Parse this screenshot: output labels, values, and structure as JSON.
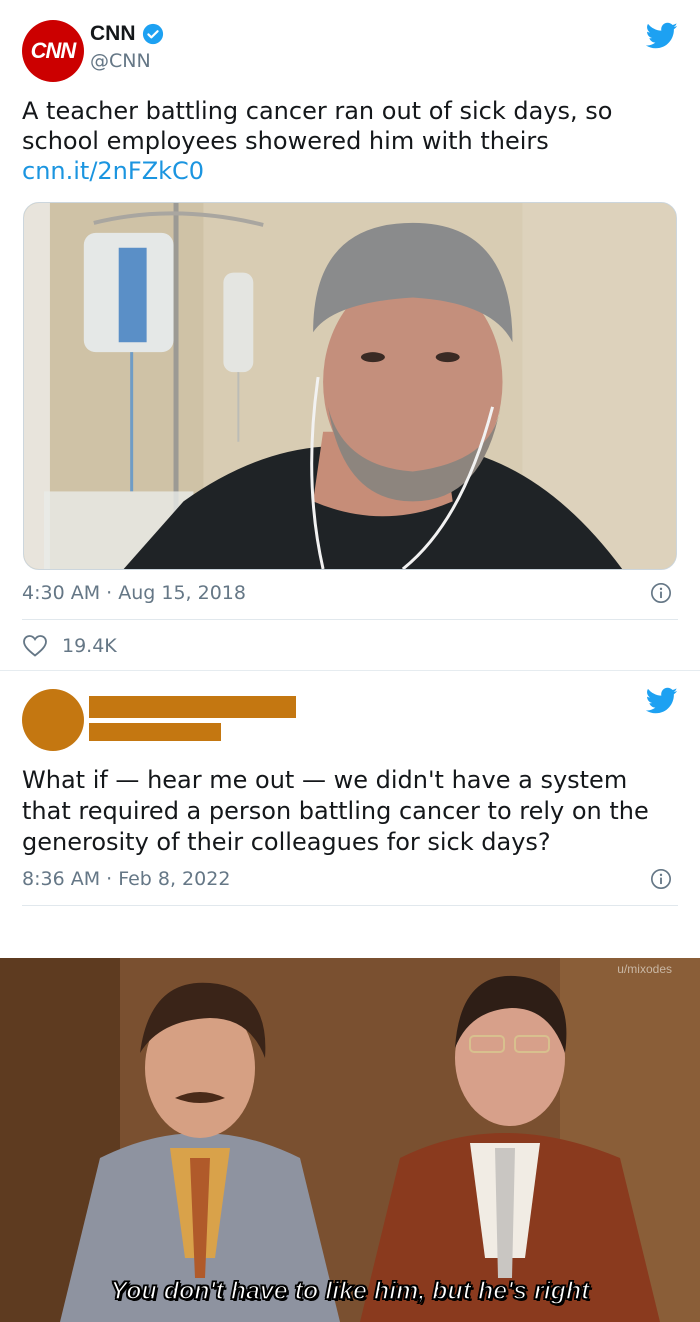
{
  "tweet1": {
    "avatar_text": "CNN",
    "name": "CNN",
    "handle": "@CNN",
    "text": "A teacher battling cancer ran out of sick days, so school employees showered him with theirs",
    "link": "cnn.it/2nFZkC0",
    "timestamp": "4:30 AM · Aug 15, 2018",
    "likes": "19.4K"
  },
  "tweet2": {
    "text": "What if — hear me out — we didn't have a system that required a person battling cancer to rely on the generosity of their colleagues for sick days?",
    "timestamp": "8:36 AM · Feb 8, 2022"
  },
  "meme": {
    "caption": "You don't have to like him, but he's right",
    "watermark": "u/mixodes"
  },
  "colors": {
    "twitter_blue": "#1da1f2",
    "link_blue": "#1b95e0",
    "cnn_red": "#cc0000",
    "redaction": "#c47711",
    "muted_text": "#657786"
  },
  "icons": [
    "verified-badge-icon",
    "twitter-bird-icon",
    "info-icon",
    "heart-icon"
  ]
}
